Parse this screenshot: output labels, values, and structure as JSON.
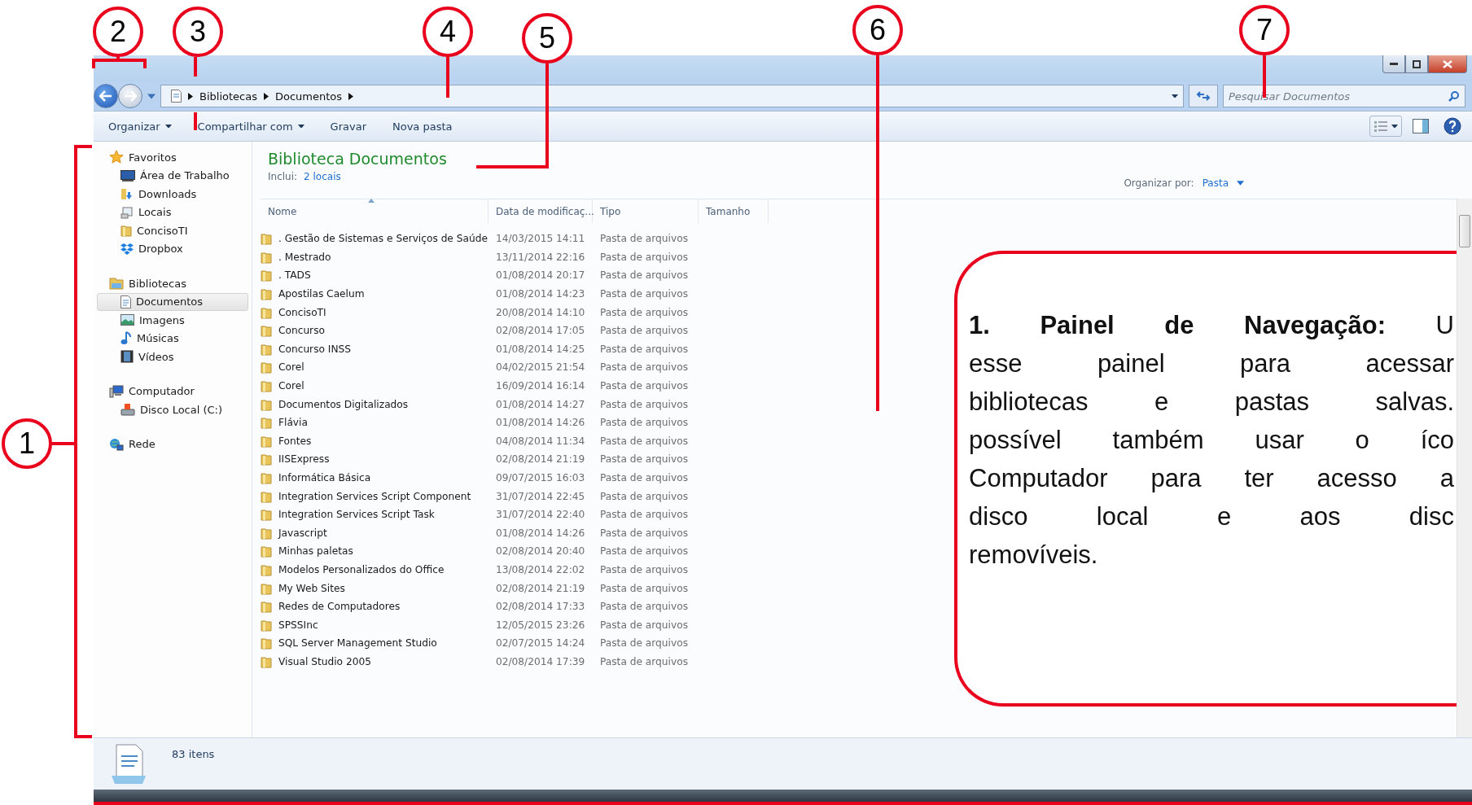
{
  "annotations": [
    {
      "number": "1"
    },
    {
      "number": "2"
    },
    {
      "number": "3"
    },
    {
      "number": "4"
    },
    {
      "number": "5"
    },
    {
      "number": "6"
    },
    {
      "number": "7"
    }
  ],
  "address": {
    "crumbs": [
      "Bibliotecas",
      "Documentos"
    ]
  },
  "search": {
    "placeholder": "Pesquisar Documentos"
  },
  "toolbar": {
    "buttons": [
      {
        "label": "Organizar",
        "dropdown": true
      },
      {
        "label": "Compartilhar com",
        "dropdown": true
      },
      {
        "label": "Gravar",
        "dropdown": false
      },
      {
        "label": "Nova pasta",
        "dropdown": false
      }
    ]
  },
  "sidebar": {
    "groups": [
      {
        "label": "Favoritos",
        "selected": false,
        "children": [
          {
            "label": "Área de Trabalho",
            "selected": false
          },
          {
            "label": "Downloads",
            "selected": false
          },
          {
            "label": "Locais",
            "selected": false
          },
          {
            "label": "ConcisoTI",
            "selected": false
          },
          {
            "label": "Dropbox",
            "selected": false
          }
        ]
      },
      {
        "label": "Bibliotecas",
        "selected": false,
        "children": [
          {
            "label": "Documentos",
            "selected": true
          },
          {
            "label": "Imagens",
            "selected": false
          },
          {
            "label": "Músicas",
            "selected": false
          },
          {
            "label": "Vídeos",
            "selected": false
          }
        ]
      },
      {
        "label": "Computador",
        "selected": false,
        "children": [
          {
            "label": "Disco Local (C:)",
            "selected": false
          }
        ]
      },
      {
        "label": "Rede",
        "selected": false
      }
    ]
  },
  "library": {
    "title": "Biblioteca Documentos",
    "includes_label": "Inclui:",
    "includes_link": "2 locais",
    "arrange_label": "Organizar por:",
    "arrange_value": "Pasta"
  },
  "table": {
    "columns": [
      "Nome",
      "Data de modificaç...",
      "Tipo",
      "Tamanho"
    ],
    "rows": [
      [
        ". Gestão de Sistemas e Serviços de Saúde",
        "14/03/2015 14:11",
        "Pasta de arquivos"
      ],
      [
        ". Mestrado",
        "13/11/2014 22:16",
        "Pasta de arquivos"
      ],
      [
        ". TADS",
        "01/08/2014 20:17",
        "Pasta de arquivos"
      ],
      [
        "Apostilas Caelum",
        "01/08/2014 14:23",
        "Pasta de arquivos"
      ],
      [
        "ConcisoTI",
        "20/08/2014 14:10",
        "Pasta de arquivos"
      ],
      [
        "Concurso",
        "02/08/2014 17:05",
        "Pasta de arquivos"
      ],
      [
        "Concurso INSS",
        "01/08/2014 14:25",
        "Pasta de arquivos"
      ],
      [
        "Corel",
        "04/02/2015 21:54",
        "Pasta de arquivos"
      ],
      [
        "Corel",
        "16/09/2014 16:14",
        "Pasta de arquivos"
      ],
      [
        "Documentos Digitalizados",
        "01/08/2014 14:27",
        "Pasta de arquivos"
      ],
      [
        "Flávia",
        "01/08/2014 14:26",
        "Pasta de arquivos"
      ],
      [
        "Fontes",
        "04/08/2014 11:34",
        "Pasta de arquivos"
      ],
      [
        "IISExpress",
        "02/08/2014 21:19",
        "Pasta de arquivos"
      ],
      [
        "Informática Básica",
        "09/07/2015 16:03",
        "Pasta de arquivos"
      ],
      [
        "Integration Services Script Component",
        "31/07/2014 22:45",
        "Pasta de arquivos"
      ],
      [
        "Integration Services Script Task",
        "31/07/2014 22:40",
        "Pasta de arquivos"
      ],
      [
        "Javascript",
        "01/08/2014 14:26",
        "Pasta de arquivos"
      ],
      [
        "Minhas paletas",
        "02/08/2014 20:40",
        "Pasta de arquivos"
      ],
      [
        "Modelos Personalizados do Office",
        "13/08/2014 22:02",
        "Pasta de arquivos"
      ],
      [
        "My Web Sites",
        "02/08/2014 21:19",
        "Pasta de arquivos"
      ],
      [
        "Redes de Computadores",
        "02/08/2014 17:33",
        "Pasta de arquivos"
      ],
      [
        "SPSSInc",
        "12/05/2015 23:26",
        "Pasta de arquivos"
      ],
      [
        "SQL Server Management Studio",
        "02/07/2015 14:24",
        "Pasta de arquivos"
      ],
      [
        "Visual Studio 2005",
        "02/08/2014 17:39",
        "Pasta de arquivos"
      ]
    ]
  },
  "status_bar": {
    "count": "83 itens"
  },
  "callout": {
    "lines": [
      "**1. Painel de Navegação:** U",
      "esse painel para acessar",
      "bibliotecas e pastas salvas.",
      "possível também usar o íco",
      "Computador para ter acesso a",
      "disco local e aos disc",
      "removíveis."
    ]
  }
}
